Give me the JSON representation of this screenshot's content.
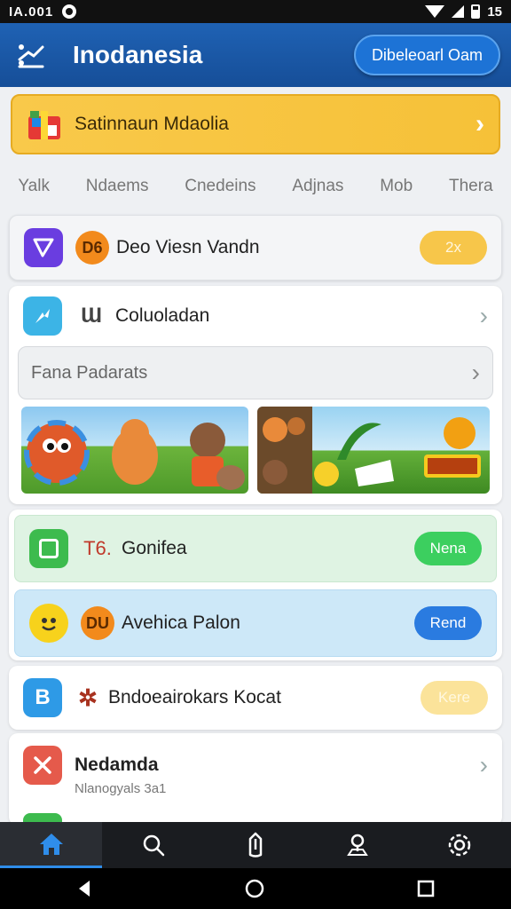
{
  "status_bar": {
    "left_text": "IA.001",
    "battery": "15"
  },
  "app_bar": {
    "title": "Inodanesia",
    "cta_label": "Dibeleoarl Oam"
  },
  "promo_banner": {
    "label": "Satinnaun Mdaolia"
  },
  "tabs": [
    "Yalk",
    "Ndaems",
    "Cnedeins",
    "Adjnas",
    "Mob",
    "Thera"
  ],
  "rows": {
    "row1": {
      "badge": "D6",
      "label": "Deo Viesn Vandn",
      "pill": "2x"
    },
    "row2": {
      "badge": "Ɯ",
      "label": "Coluoladan"
    },
    "search": {
      "label": "Fana Padarats"
    },
    "row3": {
      "badge": "T6.",
      "label": "Gonifea",
      "pill": "Nena"
    },
    "row4": {
      "badge": "DU",
      "label": "Avehica Palon",
      "pill": "Rend"
    },
    "row5": {
      "label": "Bndoeairokars Kocat",
      "pill": "Kere"
    },
    "row6": {
      "title": "Nedamda",
      "subtitle": "Nlanogyals 3a1"
    }
  },
  "colors": {
    "app_bar": "#1f62b4",
    "banner": "#f7c43c",
    "green_pill": "#3ccf5f",
    "blue_pill": "#2a7be0",
    "yellow_pill": "#f7c64a",
    "accent_nav": "#2f8dea"
  },
  "icons": {
    "app_bar": "menu-chart-icon",
    "banner": "gift-icon",
    "row1": "send-icon",
    "row2": "arrow-icon",
    "row3": "square-icon",
    "row4": "smiley-icon",
    "row5": "b-icon",
    "row6": "close-icon",
    "nav": [
      "home-icon",
      "search-icon",
      "upload-icon",
      "location-icon",
      "settings-icon"
    ]
  }
}
